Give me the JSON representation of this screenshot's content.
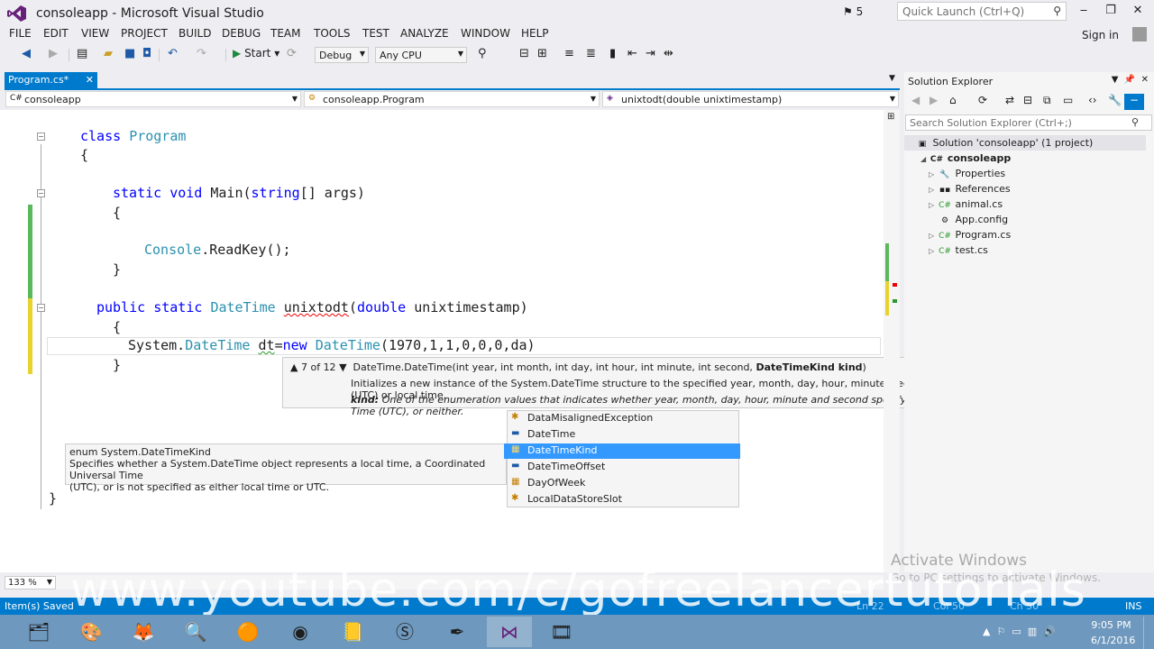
{
  "window": {
    "title": "consoleapp - Microsoft Visual Studio",
    "notifications": "5",
    "quick_launch_placeholder": "Quick Launch (Ctrl+Q)",
    "sign_in": "Sign in"
  },
  "menu": [
    "FILE",
    "EDIT",
    "VIEW",
    "PROJECT",
    "BUILD",
    "DEBUG",
    "TEAM",
    "TOOLS",
    "TEST",
    "ANALYZE",
    "WINDOW",
    "HELP"
  ],
  "toolbar": {
    "start_label": "Start",
    "config": "Debug",
    "platform": "Any CPU"
  },
  "doc_tab": {
    "label": "Program.cs*"
  },
  "nav": {
    "project": "consoleapp",
    "class": "consoleapp.Program",
    "member": "unixtodt(double unixtimestamp)"
  },
  "code": {
    "l1_kw": "class",
    "l1_ty": "Program",
    "l2": "{",
    "l3_kw1": "static",
    "l3_kw2": "void",
    "l3_name": "Main(",
    "l3_kw3": "string",
    "l3_rest": "[] args)",
    "l4": "{",
    "l5_ty": "Console",
    "l5_rest": ".ReadKey();",
    "l6": "}",
    "l7_kw1": "public",
    "l7_kw2": "static",
    "l7_ty": "DateTime",
    "l7_name": "unixtodt",
    "l7_paren": "(",
    "l7_kw3": "double",
    "l7_rest": "unixtimestamp)",
    "l8": "{",
    "l9_a": "System.",
    "l9_ty": "DateTime",
    "l9_var": "dt",
    "l9_eq": "=",
    "l9_kw": "new",
    "l9_ty2": "DateTime",
    "l9_args": "(1970,1,1,0,0,0,da)",
    "l10": "}",
    "l11": "}"
  },
  "param_tip": {
    "counter": "7 of 12",
    "signature_start": "DateTime.DateTime(int year, int month, int day, int hour, int minute, int second, ",
    "signature_bold": "DateTimeKind kind",
    "signature_end": ")",
    "description": "Initializes a new instance of the System.DateTime structure to the specified year, month, day, hour, minute, second, and Coordinated Universal Time (UTC) or local time.",
    "param_name": "kind:",
    "param_desc": "One of the enumeration values that indicates whether year, month, day, hour, minute and second specify a local time, Coordinated Universal Time (UTC), or neither."
  },
  "completion": [
    {
      "label": "DataMisalignedException",
      "icon": "class-icon"
    },
    {
      "label": "DateTime",
      "icon": "struct-icon"
    },
    {
      "label": "DateTimeKind",
      "icon": "enum-icon",
      "selected": true
    },
    {
      "label": "DateTimeOffset",
      "icon": "struct-icon"
    },
    {
      "label": "DayOfWeek",
      "icon": "enum-icon"
    },
    {
      "label": "LocalDataStoreSlot",
      "icon": "class-icon"
    }
  ],
  "quick_info": {
    "line1": "enum System.DateTimeKind",
    "line2": "Specifies whether a System.DateTime object represents a local time, a Coordinated Universal Time",
    "line3": "(UTC), or is not specified as either local time or UTC."
  },
  "zoom": "133 %",
  "solution_explorer": {
    "title": "Solution Explorer",
    "search_placeholder": "Search Solution Explorer (Ctrl+;)",
    "solution": "Solution 'consoleapp' (1 project)",
    "project": "consoleapp",
    "items": [
      "Properties",
      "References",
      "animal.cs",
      "App.config",
      "Program.cs",
      "test.cs"
    ]
  },
  "status": {
    "text": "Item(s) Saved",
    "ins": "INS",
    "ln": "Ln 22",
    "col": "Col 50",
    "ch": "Ch 50"
  },
  "activate": {
    "line1": "Activate Windows",
    "line2": "Go to PC settings to activate Windows."
  },
  "watermark": "www.youtube.com/c/gofreelancertutorials",
  "clock": {
    "time": "9:05 PM",
    "date": "6/1/2016"
  },
  "colors": {
    "accent": "#007acc",
    "selection": "#3399ff",
    "keyword": "#0000ff",
    "type": "#2b91af"
  }
}
